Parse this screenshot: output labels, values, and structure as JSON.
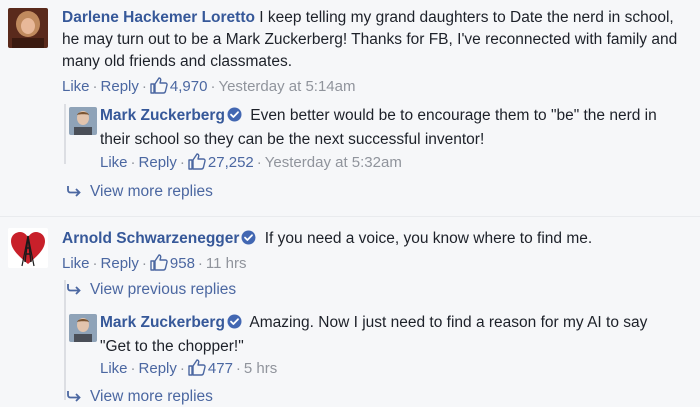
{
  "comments": [
    {
      "name": "Darlene Hackemer Loretto",
      "body": " I keep telling my grand daughters to Date the nerd in school, he may turn out to be a Mark Zuckerberg! Thanks for FB, I've reconnected with family and many old friends and classmates.",
      "like_label": "Like",
      "reply_label": "Reply",
      "likes": "4,970",
      "time": "Yesterday at 5:14am"
    },
    {
      "name": "Mark Zuckerberg",
      "body": " Even better would be to encourage them to \"be\" the nerd in their school so they can be the next successful inventor!",
      "like_label": "Like",
      "reply_label": "Reply",
      "likes": "27,252",
      "time": "Yesterday at 5:32am"
    },
    {
      "name": "Arnold Schwarzenegger",
      "body": " If you need a voice, you know where to find me.",
      "like_label": "Like",
      "reply_label": "Reply",
      "likes": "958",
      "time": "11 hrs"
    },
    {
      "name": "Mark Zuckerberg",
      "body": " Amazing. Now I just need to find a reason for my AI to say \"Get to the chopper!\"",
      "like_label": "Like",
      "reply_label": "Reply",
      "likes": "477",
      "time": "5 hrs"
    }
  ],
  "links": {
    "view_more_replies": "View more replies",
    "view_previous_replies": "View previous replies",
    "view_more_replies_2": "View more replies"
  },
  "colors": {
    "link": "#365899",
    "meta": "#90949c",
    "verified": "#4267b2",
    "background": "#f6f7f9"
  },
  "icons": [
    "verified-badge-icon",
    "thumbs-up-icon",
    "reply-arrow-icon"
  ]
}
